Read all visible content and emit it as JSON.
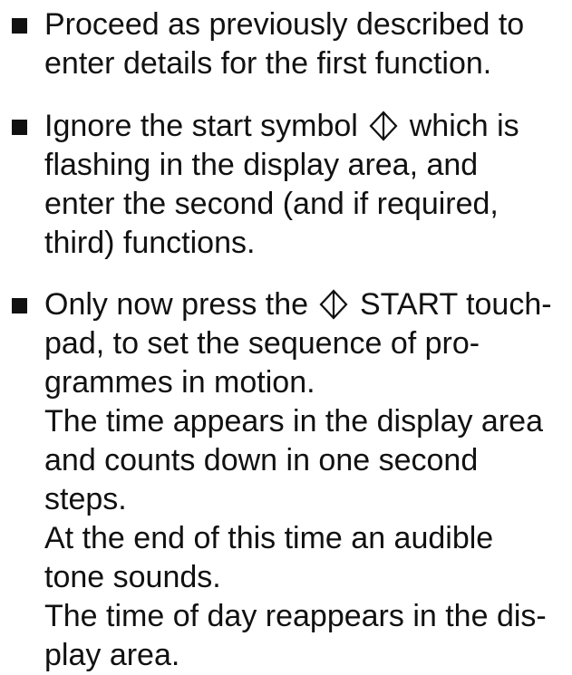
{
  "instructions": {
    "item1": {
      "line1": "Proceed as previously described to",
      "line2": "enter details for the first function."
    },
    "item2": {
      "line1_before": "Ignore the start symbol",
      "line1_after": "which is",
      "line2": "flashing in the display area, and",
      "line3": "enter the second (and if required,",
      "line4": "third) functions."
    },
    "item3": {
      "line1_before": "Only now press the",
      "line1_after": "START touch-",
      "line2": "pad, to set the sequence of pro-",
      "line3": "grammes in motion.",
      "line4": "The time appears in the display area",
      "line5": "and counts down in one second",
      "line6": "steps.",
      "line7": "At the end of this time an audible",
      "line8": "tone sounds.",
      "line9": "The time of day reappears in the dis-",
      "line10": "play area."
    },
    "icons": {
      "bullet": "square-bullet-icon",
      "start": "start-symbol-icon"
    }
  }
}
